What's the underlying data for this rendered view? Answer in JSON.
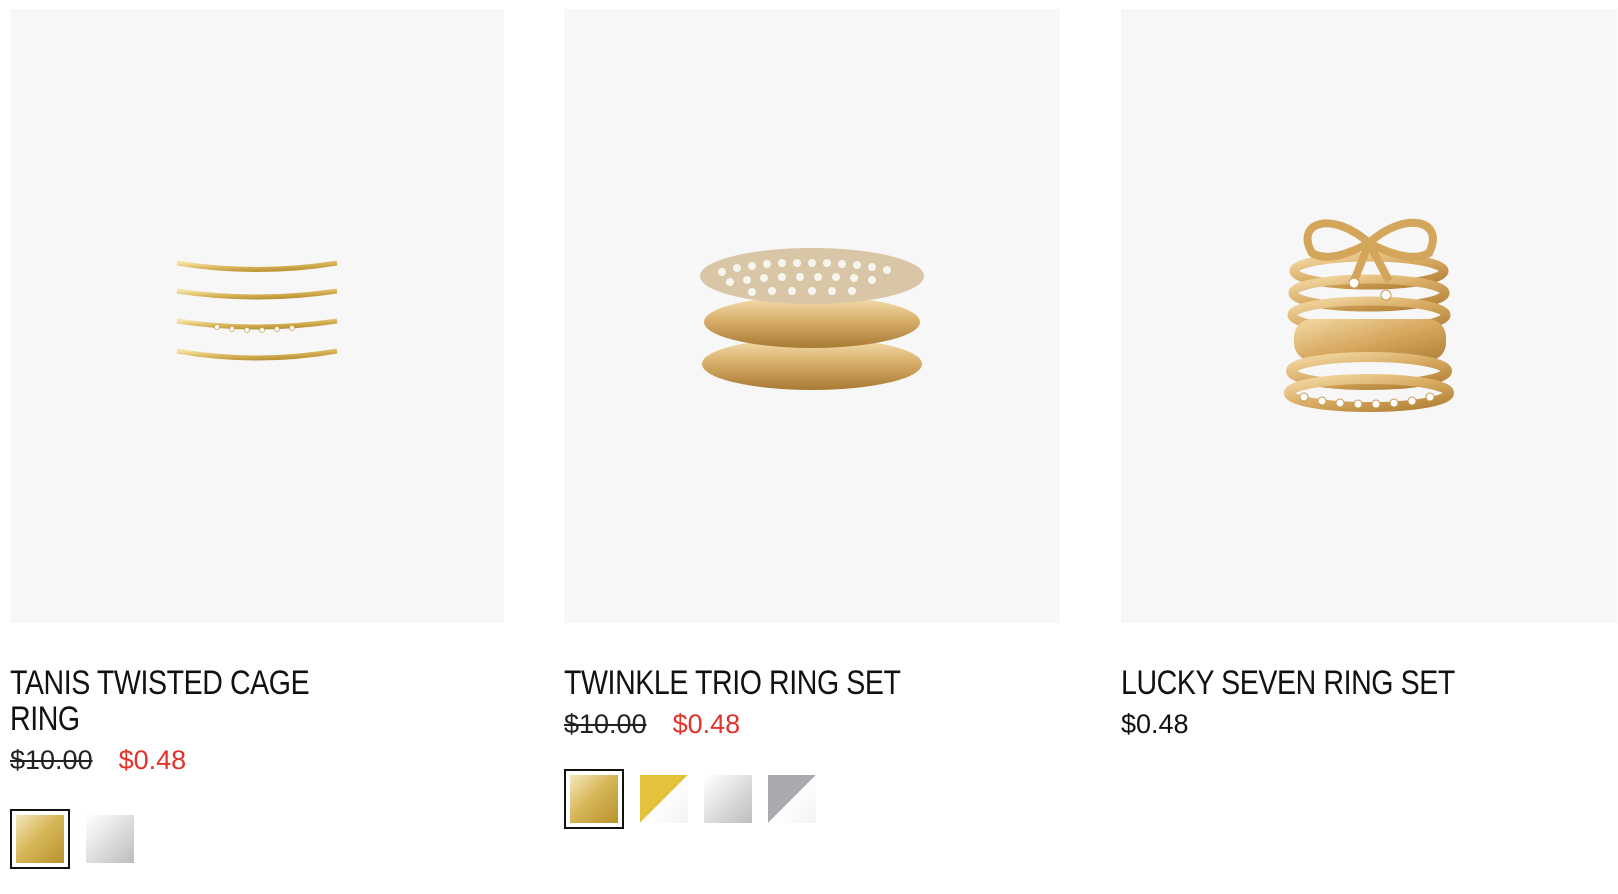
{
  "products": [
    {
      "name": "TANIS TWISTED CAGE RING",
      "original_price": "$10.00",
      "sale_price": "$0.48",
      "swatches": [
        {
          "color": "gold",
          "selected": true
        },
        {
          "color": "silver",
          "selected": false
        }
      ]
    },
    {
      "name": "TWINKLE TRIO RING SET",
      "original_price": "$10.00",
      "sale_price": "$0.48",
      "swatches": [
        {
          "color": "gold",
          "selected": true
        },
        {
          "color": "gold-white",
          "selected": false
        },
        {
          "color": "silver",
          "selected": false
        },
        {
          "color": "grey-white",
          "selected": false
        }
      ]
    },
    {
      "name": "LUCKY SEVEN RING SET",
      "price": "$0.48"
    }
  ],
  "colors": {
    "sale": "#e2332b",
    "image_bg": "#f7f7f7",
    "gold": "#d8b85a"
  }
}
